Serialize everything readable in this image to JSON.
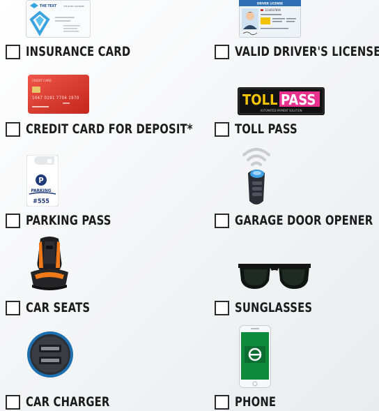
{
  "items": [
    {
      "label": "Insurance Card"
    },
    {
      "label": "Valid Driver's License"
    },
    {
      "label": "Credit Card for Deposit*"
    },
    {
      "label": "Toll Pass"
    },
    {
      "label": "Parking Pass"
    },
    {
      "label": "Garage Door Opener"
    },
    {
      "label": "Car Seats"
    },
    {
      "label": "Sunglasses"
    },
    {
      "label": "Car Charger"
    },
    {
      "label": "Phone"
    }
  ],
  "art_text": {
    "insurance_brand": "THE TEXT",
    "insurance_small": "THE NAME LASTNAME",
    "license_header": "DRIVER LICENSE",
    "license_id": "1234567890",
    "credit_header": "CREDIT CARD",
    "credit_number": "1047 0191 7704 1970",
    "tollpass_toll": "TOLL",
    "tollpass_pass": "PASS",
    "tollpass_sub": "AUTOMATED PAYMENT SOLUTION",
    "parking_p": "P",
    "parking_word": "PARKING",
    "parking_num": "#555"
  },
  "colors": {
    "credit_card": "#e23b2e",
    "license_blue": "#2e6fb3",
    "tollpass_yellow": "#f5c400",
    "tollpass_pink": "#e8318f",
    "parking_blue": "#1f3a78",
    "enterprise_green": "#0f8a3d",
    "charger_blue": "#1d6fb0"
  }
}
